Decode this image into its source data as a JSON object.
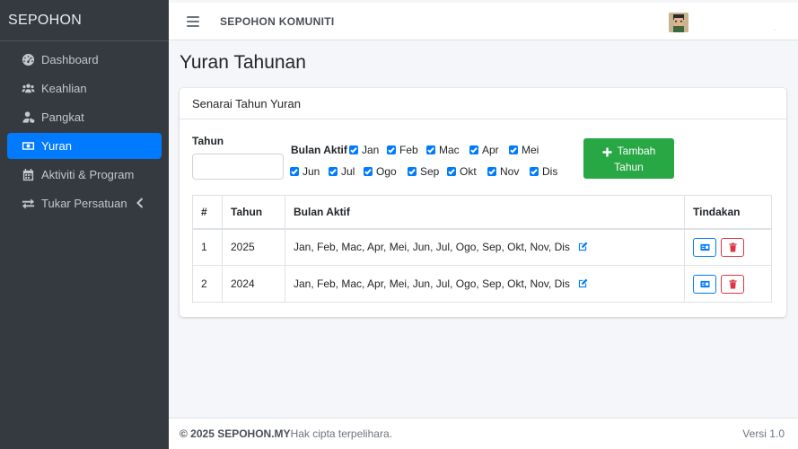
{
  "sidebar": {
    "brand": "SEPOHON",
    "items": [
      {
        "label": "Dashboard",
        "icon": "dashboard-icon"
      },
      {
        "label": "Keahlian",
        "icon": "users-icon"
      },
      {
        "label": "Pangkat",
        "icon": "user-tie-icon"
      },
      {
        "label": "Yuran",
        "icon": "money-icon"
      },
      {
        "label": "Aktiviti & Program",
        "icon": "calendar-icon"
      },
      {
        "label": "Tukar Persatuan",
        "icon": "exchange-icon"
      }
    ],
    "active_index": 3
  },
  "topbar": {
    "title": "SEPOHON KOMUNITI",
    "trailing_text": "."
  },
  "page": {
    "title": "Yuran Tahunan"
  },
  "card": {
    "header": "Senarai Tahun Yuran",
    "form": {
      "year_label": "Tahun",
      "year_value": "",
      "months_label": "Bulan Aktif",
      "months": [
        "Jan",
        "Feb",
        "Mac",
        "Apr",
        "Mei",
        "Jun",
        "Jul",
        "Ogo",
        "Sep",
        "Okt",
        "Nov",
        "Dis"
      ],
      "add_button_line1": "Tambah",
      "add_button_line2": "Tahun"
    },
    "table": {
      "headers": [
        "#",
        "Tahun",
        "Bulan Aktif",
        "Tindakan"
      ],
      "rows": [
        {
          "num": "1",
          "year": "2025",
          "months": "Jan, Feb, Mac, Apr, Mei, Jun, Jul, Ogo, Sep, Okt, Nov, Dis"
        },
        {
          "num": "2",
          "year": "2024",
          "months": "Jan, Feb, Mac, Apr, Mei, Jun, Jul, Ogo, Sep, Okt, Nov, Dis"
        }
      ]
    }
  },
  "footer": {
    "copyright": "© 2025 SEPOHON.MY",
    "rights": " Hak cipta terpelihara.",
    "version": "Versi 1.0"
  },
  "colors": {
    "sidebar_bg": "#343a40",
    "active": "#007bff",
    "success": "#28a745",
    "danger": "#dc3545"
  }
}
